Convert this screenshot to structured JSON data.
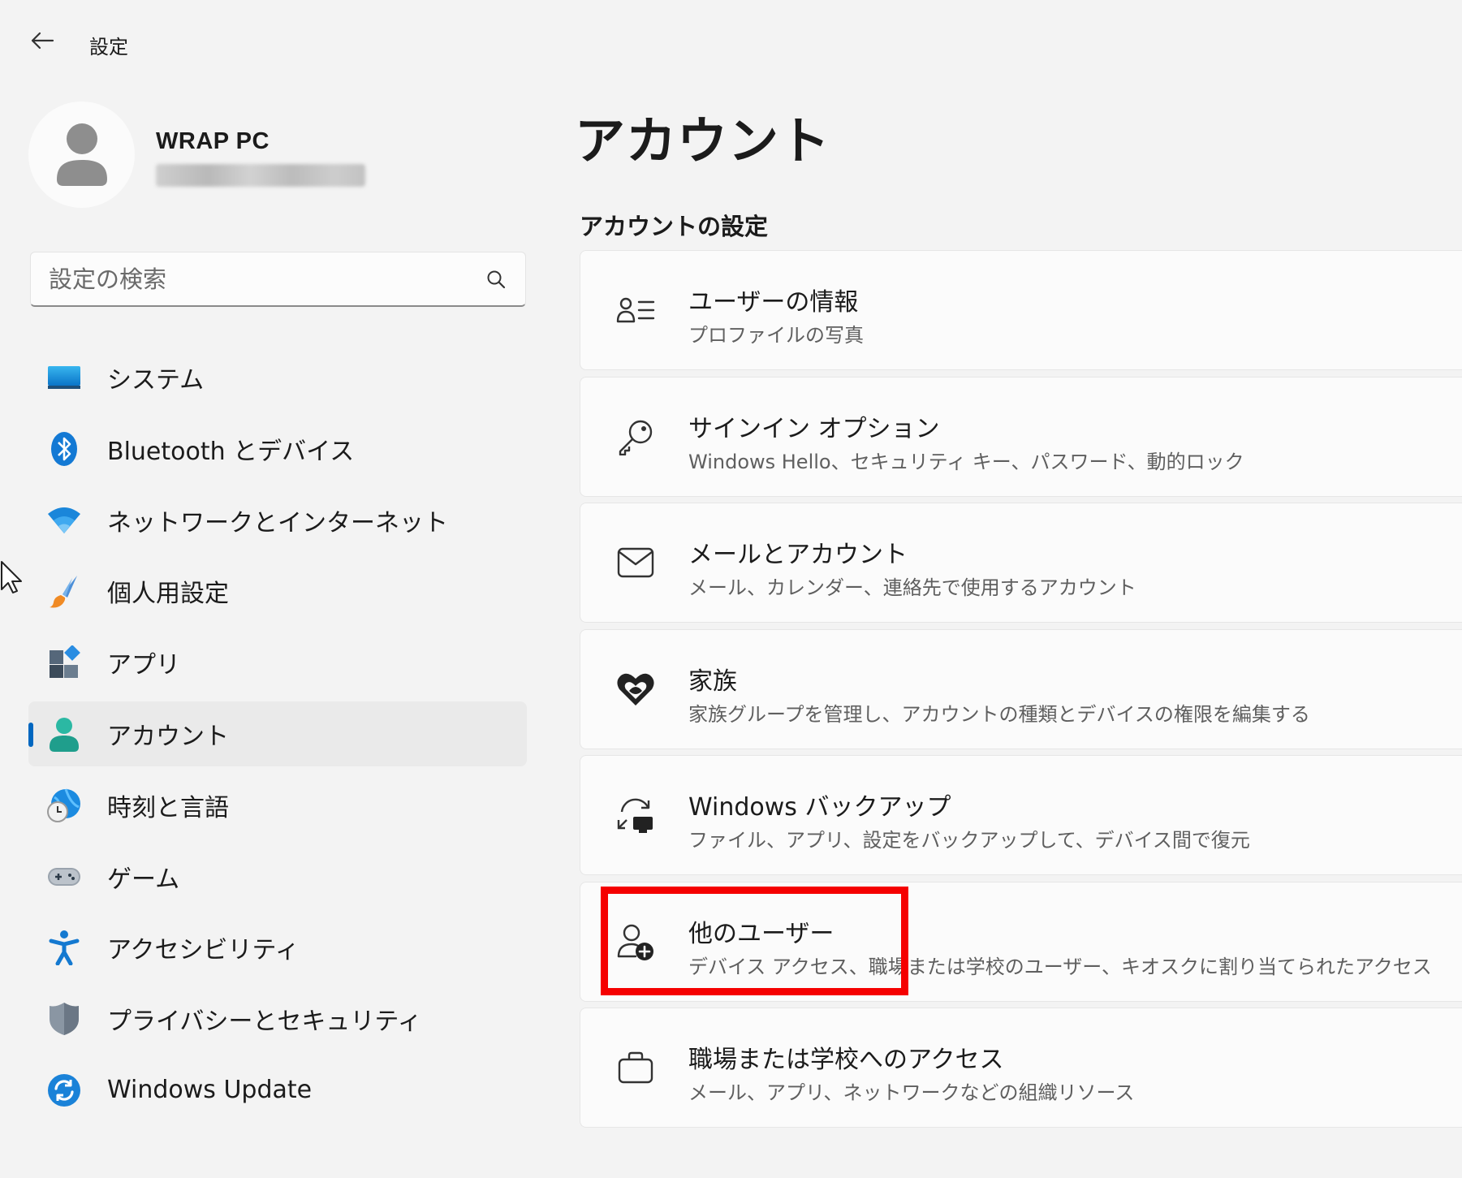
{
  "titlebar": {
    "title": "設定",
    "back_icon": "arrow-left-icon"
  },
  "profile": {
    "name": "WRAP PC",
    "email": "••••••••••••••••••••"
  },
  "search": {
    "placeholder": "設定の検索",
    "value": ""
  },
  "sidebar": {
    "items": [
      {
        "label": "システム",
        "icon": "monitor-icon",
        "color": "#0078d4"
      },
      {
        "label": "Bluetooth とデバイス",
        "icon": "bluetooth-icon",
        "color": "#0078d4"
      },
      {
        "label": "ネットワークとインターネット",
        "icon": "wifi-icon",
        "color": "#0078d4"
      },
      {
        "label": "個人用設定",
        "icon": "paintbrush-icon",
        "color": "#e8833a"
      },
      {
        "label": "アプリ",
        "icon": "apps-icon",
        "color": "#4a5a6a"
      },
      {
        "label": "アカウント",
        "icon": "person-icon",
        "color": "#2bb8a3",
        "selected": true
      },
      {
        "label": "時刻と言語",
        "icon": "globe-clock-icon",
        "color": "#0078d4"
      },
      {
        "label": "ゲーム",
        "icon": "gamepad-icon",
        "color": "#8a8a8a"
      },
      {
        "label": "アクセシビリティ",
        "icon": "accessibility-icon",
        "color": "#0078d4"
      },
      {
        "label": "プライバシーとセキュリティ",
        "icon": "shield-icon",
        "color": "#6b7785"
      },
      {
        "label": "Windows Update",
        "icon": "sync-icon",
        "color": "#0078d4"
      }
    ]
  },
  "main": {
    "title": "アカウント",
    "section_title": "アカウントの設定",
    "cards": [
      {
        "title": "ユーザーの情報",
        "subtitle": "プロファイルの写真",
        "icon": "person-list-icon"
      },
      {
        "title": "サインイン オプション",
        "subtitle": "Windows Hello、セキュリティ キー、パスワード、動的ロック",
        "icon": "key-icon"
      },
      {
        "title": "メールとアカウント",
        "subtitle": "メール、カレンダー、連絡先で使用するアカウント",
        "icon": "mail-icon"
      },
      {
        "title": "家族",
        "subtitle": "家族グループを管理し、アカウントの種類とデバイスの権限を編集する",
        "icon": "family-heart-icon"
      },
      {
        "title": "Windows バックアップ",
        "subtitle": "ファイル、アプリ、設定をバックアップして、デバイス間で復元",
        "icon": "backup-icon"
      },
      {
        "title": "他のユーザー",
        "subtitle": "デバイス アクセス、職場または学校のユーザー、キオスクに割り当てられたアクセス",
        "icon": "person-add-icon"
      },
      {
        "title": "職場または学校へのアクセス",
        "subtitle": "メール、アプリ、ネットワークなどの組織リソース",
        "icon": "briefcase-icon"
      }
    ]
  },
  "colors": {
    "accent": "#0067c0",
    "highlight": "#f50000",
    "background": "#f3f3f3",
    "card": "#fbfbfb"
  }
}
